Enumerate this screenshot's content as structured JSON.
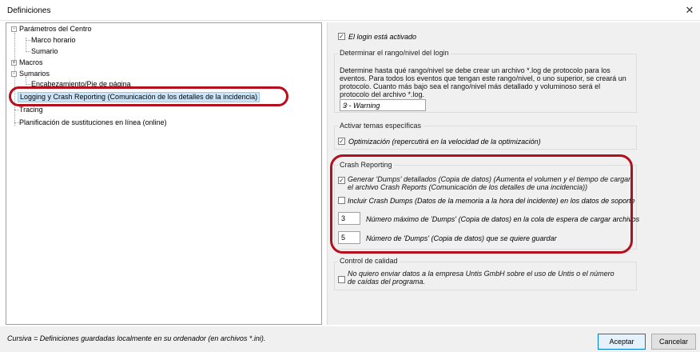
{
  "window": {
    "title": "Definiciones",
    "close_glyph": "✕"
  },
  "tree": {
    "items": [
      "Parámetros del Centro",
      "Marco horario",
      "Sumario",
      "Macros",
      "Sumarios",
      "Encabezamiento/Pie de página",
      "Logging y Crash Reporting (Comunicación de los detalles de la incidencia)",
      "Tracing",
      "Planificación de sustituciones en línea (online)"
    ],
    "expanders": [
      "-",
      "+",
      "-"
    ]
  },
  "settings": {
    "login_active": "El login está activado",
    "level_group": {
      "title": "Determinar el rango/nivel del login",
      "description": "Determine hasta qué rango/nivel se debe crear un archivo *.log de protocolo para los eventos. Para todos los eventos que tengan este rango/nivel, o uno superior, se creará un protocolo. Cuanto más bajo sea el rango/nivel más detallado y voluminoso será el protocolo del archivo *.log.",
      "selected": "3 - Warning"
    },
    "topics_group": {
      "title": "Activar temas específicas",
      "optimization": "Optimización (repercutirá en la velocidad de la optimización)"
    },
    "crash_group": {
      "title": "Crash Reporting",
      "detailed_dumps": "Generar 'Dumps' detallados (Copia de datos) (Aumenta el volumen y el tiempo de cargar el archivo Crash Reports (Comunicación de los detalles de una incidencia))",
      "include_dumps": "Incluir Crash Dumps (Datos de la memoria a la hora del incidente) en los datos de soporte",
      "max_dumps_value": "3",
      "max_dumps_label": "Número máximo de 'Dumps' (Copia de datos) en la cola de espera de cargar archivos",
      "keep_dumps_value": "5",
      "keep_dumps_label": "Número de 'Dumps' (Copia de datos) que se quiere guardar"
    },
    "quality_group": {
      "title": "Control de calidad",
      "no_send": "No quiero enviar datos a la empresa Untis GmbH sobre el uso de Untis o el número de caídas del programa."
    }
  },
  "footer": {
    "note": "Cursiva = Definiciones guardadas localmente en su ordenador (en archivos *.ini).",
    "accept": "Aceptar",
    "cancel": "Cancelar"
  },
  "colors": {
    "highlight": "#b40f1c",
    "selection": "#cce4f7",
    "panel": "#f0f0f0"
  }
}
